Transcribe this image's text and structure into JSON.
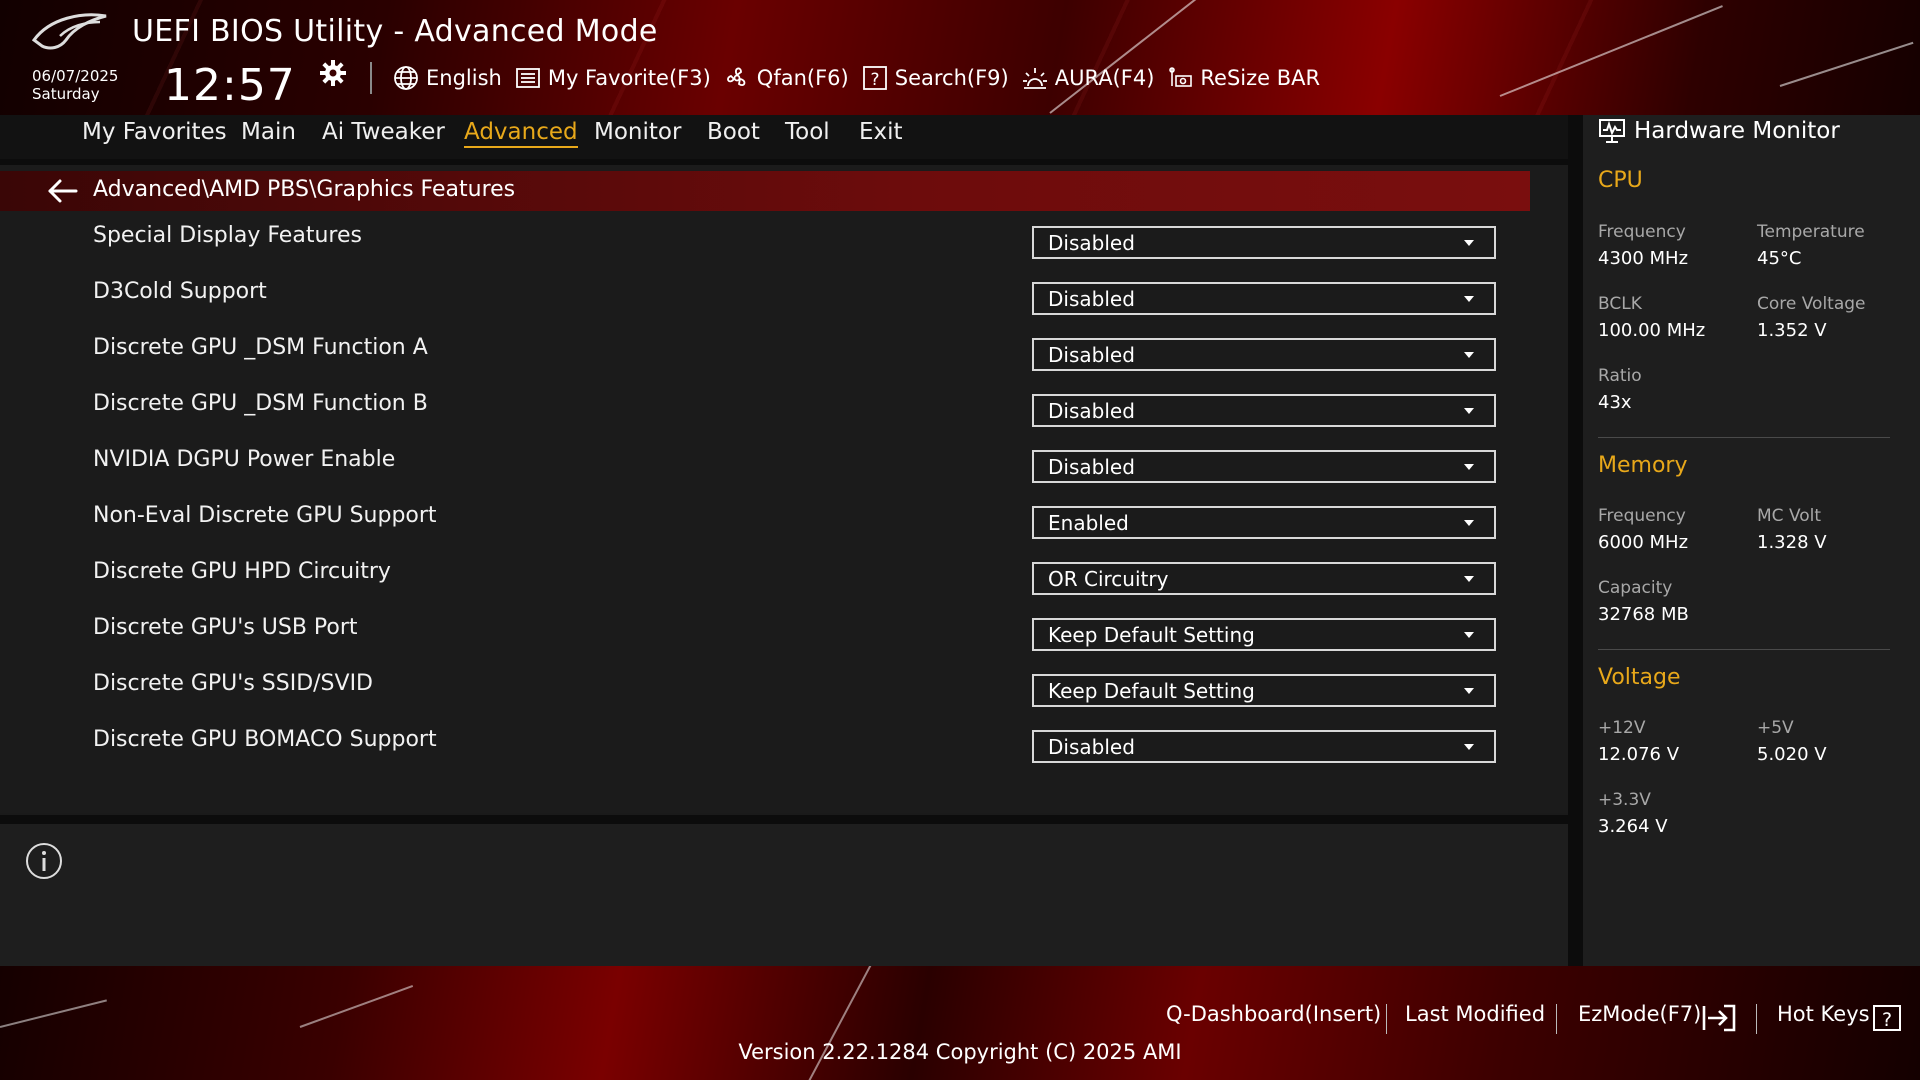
{
  "header": {
    "title": "UEFI BIOS Utility - Advanced Mode",
    "date": "06/07/2025",
    "day": "Saturday",
    "time": "12:57",
    "tools": [
      {
        "label": "English",
        "icon": "globe-icon"
      },
      {
        "label": "My Favorite(F3)",
        "icon": "favorite-list-icon"
      },
      {
        "label": "Qfan(F6)",
        "icon": "fan-icon"
      },
      {
        "label": "Search(F9)",
        "icon": "question-box-icon"
      },
      {
        "label": "AURA(F4)",
        "icon": "aura-light-icon"
      },
      {
        "label": "ReSize BAR",
        "icon": "resize-bar-icon"
      }
    ]
  },
  "nav": {
    "tabs": [
      "My Favorites",
      "Main",
      "Ai Tweaker",
      "Advanced",
      "Monitor",
      "Boot",
      "Tool",
      "Exit"
    ],
    "active": "Advanced"
  },
  "breadcrumb": "Advanced\\AMD PBS\\Graphics Features",
  "settings": [
    {
      "label": "Special Display Features",
      "value": "Disabled"
    },
    {
      "label": "D3Cold Support",
      "value": "Disabled"
    },
    {
      "label": "Discrete GPU _DSM Function A",
      "value": "Disabled"
    },
    {
      "label": "Discrete GPU _DSM Function B",
      "value": "Disabled"
    },
    {
      "label": "NVIDIA DGPU Power Enable",
      "value": "Disabled"
    },
    {
      "label": "Non-Eval Discrete GPU Support",
      "value": "Enabled"
    },
    {
      "label": "Discrete GPU HPD Circuitry",
      "value": "OR Circuitry"
    },
    {
      "label": "Discrete GPU's USB Port",
      "value": "Keep Default Setting"
    },
    {
      "label": "Discrete GPU's SSID/SVID",
      "value": "Keep Default Setting"
    },
    {
      "label": "Discrete GPU BOMACO Support",
      "value": "Disabled"
    }
  ],
  "hardware_monitor": {
    "title": "Hardware Monitor",
    "cpu": {
      "heading": "CPU",
      "frequency_label": "Frequency",
      "frequency": "4300 MHz",
      "temperature_label": "Temperature",
      "temperature": "45°C",
      "bclk_label": "BCLK",
      "bclk": "100.00 MHz",
      "core_voltage_label": "Core Voltage",
      "core_voltage": "1.352 V",
      "ratio_label": "Ratio",
      "ratio": "43x"
    },
    "memory": {
      "heading": "Memory",
      "frequency_label": "Frequency",
      "frequency": "6000 MHz",
      "mc_volt_label": "MC Volt",
      "mc_volt": "1.328 V",
      "capacity_label": "Capacity",
      "capacity": "32768 MB"
    },
    "voltage": {
      "heading": "Voltage",
      "v12_label": "+12V",
      "v12": "12.076 V",
      "v5_label": "+5V",
      "v5": "5.020 V",
      "v33_label": "+3.3V",
      "v33": "3.264 V"
    }
  },
  "footer": {
    "qdashboard": "Q-Dashboard(Insert)",
    "last_modified": "Last Modified",
    "ezmode": "EzMode(F7)",
    "hotkeys": "Hot Keys",
    "version": "Version 2.22.1284 Copyright (C) 2025 AMI"
  },
  "colors": {
    "accent": "#e8a81a",
    "breadcrumb_bar": "#6d0c0c",
    "panel": "#1b1b1b"
  }
}
